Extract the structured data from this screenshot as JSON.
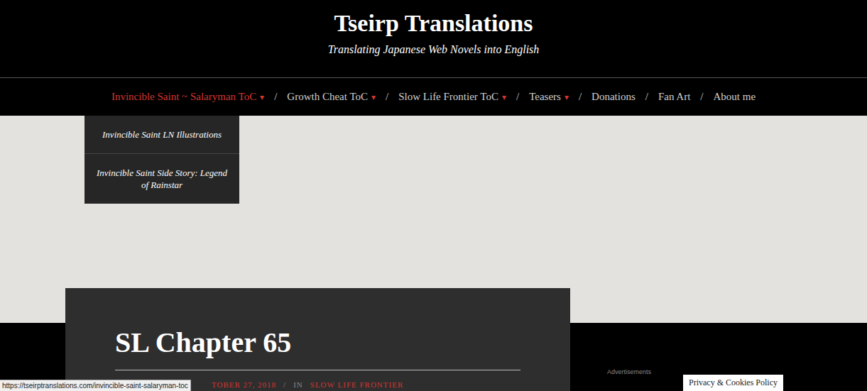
{
  "site": {
    "title": "Tseirp Translations",
    "tagline": "Translating Japanese Web Novels into English"
  },
  "nav": {
    "separator": "/",
    "caret": "▾",
    "items": [
      {
        "label": "Invincible Saint ~ Salaryman ToC",
        "has_menu": true,
        "selected": true
      },
      {
        "label": "Growth Cheat ToC",
        "has_menu": true,
        "selected": false
      },
      {
        "label": "Slow Life Frontier ToC",
        "has_menu": true,
        "selected": false
      },
      {
        "label": "Teasers",
        "has_menu": true,
        "selected": false
      },
      {
        "label": "Donations",
        "has_menu": false,
        "selected": false
      },
      {
        "label": "Fan Art",
        "has_menu": false,
        "selected": false
      },
      {
        "label": "About me",
        "has_menu": false,
        "selected": false
      }
    ]
  },
  "dropdown": {
    "open": true,
    "items": [
      "Invincible Saint LN Illustrations",
      "Invincible Saint Side Story: Legend of Rainstar"
    ]
  },
  "post": {
    "title": "SL Chapter 65",
    "date": "TOBER 27, 2018",
    "meta_separator": "/",
    "category_prefix": "IN",
    "category": "SLOW LIFE FRONTIER"
  },
  "sidebar": {
    "ad_label": "Advertisements"
  },
  "status_bar": {
    "url": "https://tseirptranslations.com/invincible-saint-salaryman-toc"
  },
  "cookie_button": "Privacy & Cookies Policy"
}
